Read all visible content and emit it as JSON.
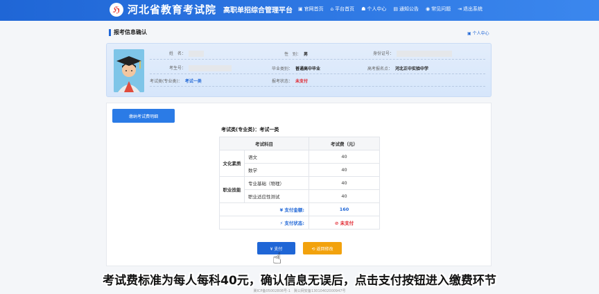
{
  "header": {
    "logo_char": "ℌ",
    "title": "河北省教育考试院",
    "subtitle": "高职单招综合管理平台",
    "nav": [
      {
        "icon": "▣",
        "label": "官网首页"
      },
      {
        "icon": "⌂",
        "label": "平台首页"
      },
      {
        "icon": "☗",
        "label": "个人中心"
      },
      {
        "icon": "▤",
        "label": "通知公告"
      },
      {
        "icon": "◉",
        "label": "常见问题"
      },
      {
        "icon": "⇥",
        "label": "退出系统"
      }
    ]
  },
  "section": {
    "title": "报考信息确认",
    "personal_link": "个人中心"
  },
  "info": {
    "name_label": "姓　名：",
    "gender_label": "性　别：",
    "gender_value": "男",
    "id_label": "身份证号：",
    "exam_no_label": "考生号：",
    "grad_type_label": "毕业类别：",
    "grad_type_value": "普通高中毕业",
    "site_label": "高考报名点：",
    "site_value": "河北正中实验中学",
    "category_label": "考试类(专业类)：",
    "category_value": "考试一类",
    "status_label": "报考状态：",
    "status_value": "未支付"
  },
  "panel": {
    "notice_button": "缴纳考试费明细",
    "exam_type": "考试类(专业类)：考试一类",
    "table": {
      "headers": [
        "考试科目",
        "考试费（元）"
      ],
      "groups": [
        {
          "name": "文化素质",
          "rows": [
            {
              "subject": "语文",
              "fee": "40"
            },
            {
              "subject": "数学",
              "fee": "40"
            }
          ]
        },
        {
          "name": "职业技能",
          "rows": [
            {
              "subject": "专业基础（物理）",
              "fee": "40"
            },
            {
              "subject": "职业适应性测试",
              "fee": "40"
            }
          ]
        }
      ],
      "total_label": "¥ 支付金额:",
      "total_value": "160",
      "pay_status_label": "⚡ 支付状态:",
      "pay_status_value": "⊘ 未支付"
    },
    "pay_button": "¥ 支付",
    "back_button": "⟲ 返回修改"
  },
  "caption": "考试费标准为每人每科40元，确认信息无误后，点击支付按钮进入缴费环节",
  "footer": "冀ICP备05002808号-1　冀公网安备13010402000947号",
  "colors": {
    "primary": "#1f66d6",
    "warning": "#f2a20d",
    "danger": "#e0232c"
  }
}
